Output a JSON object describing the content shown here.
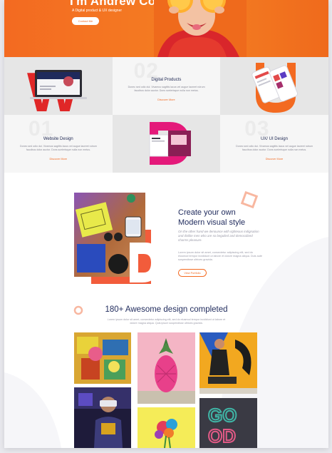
{
  "hero": {
    "title": "I'm Andrew Coldwell",
    "subtitle": "A Digital product & UX designer",
    "button_label": "Contact Me",
    "accent_color": "#f36a21"
  },
  "services": [
    {
      "number": "",
      "title": "",
      "description": "",
      "more": ""
    },
    {
      "number": "02",
      "title": "Digital Products",
      "description": "Donec sed odio dui. Vivamus sagittis lacus vel augue laoreet rutrum faucibus dolor auctor. Dons scelerisque nulla non metus.",
      "more": "Discover More"
    },
    {
      "number": "",
      "title": "",
      "description": "",
      "more": ""
    },
    {
      "number": "01",
      "title": "Website Design",
      "description": "Donec sed odio dui. Vivamus sagittis lacus vel augue laoreet rutrum faucibus dolor auctor. Dons scelerisque nulla non metus.",
      "more": "Discover More"
    },
    {
      "number": "",
      "title": "",
      "description": "",
      "more": ""
    },
    {
      "number": "03",
      "title": "UX/ UI Design",
      "description": "Donec sed odio dui. Vivamus sagittis lacus vel augue laoreet rutrum faucibus dolor auctor. Dons scelerisque nulla non metus.",
      "more": "Discover More"
    }
  ],
  "feature": {
    "title_line1": "Create your own",
    "title_line2": "Modern visual style",
    "italic_text": "On the other hand we denounce with righteous indignation and dislike men who are so beguiled and demoralized charms pleasure.",
    "body_text": "Lorem ipsum dolor sit amet, consectetur adipiscing elit, sed do eiusmod tempor incididunt ut labore et dolore magna aliqua. Duis aute suspendisse ultrices gravida.",
    "button_label": "View Portfolio"
  },
  "gallery": {
    "title": "180+ Awesome design completed",
    "subtitle": "Lorem ipsum dolor sit amet, consectetur adipiscing elit, sed do eiusmod tempor incididunt ut labore et dolore magna aliqua. Quis ipsum suspendisse ultrices gravida.",
    "images": [
      "colorful-painting",
      "pink-pineapple",
      "woman-graffiti",
      "vr-headset-man",
      "flower-bouquet",
      "good-sign"
    ]
  }
}
